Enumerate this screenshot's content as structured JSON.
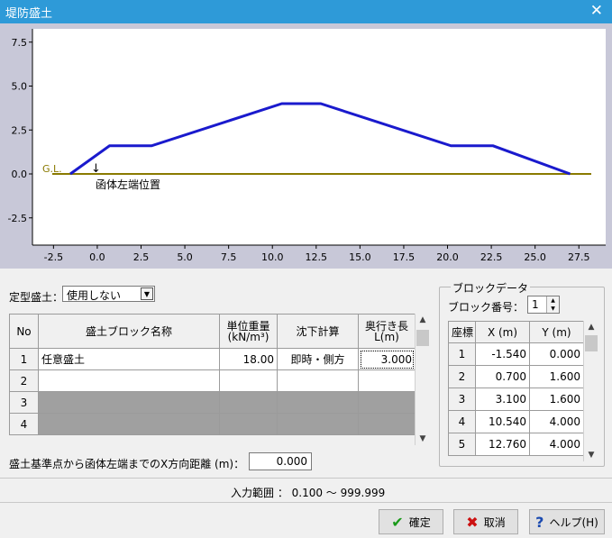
{
  "window": {
    "title": "堤防盛土",
    "close_glyph": "✕"
  },
  "plot": {
    "y_ticks": [
      "7.5",
      "5.0",
      "2.5",
      "0.0",
      "-2.5"
    ],
    "x_ticks": [
      "-2.5",
      "0.0",
      "2.5",
      "5.0",
      "7.5",
      "10.0",
      "12.5",
      "15.0",
      "17.5",
      "20.0",
      "22.5",
      "25.0",
      "27.5"
    ],
    "gl_label": "G.L.",
    "marker_label": "函体左端位置",
    "marker_arrow": "↓",
    "colors": {
      "embankment": "#1a1acd",
      "ground": "#8a7a00",
      "background": "#c8c8d8"
    },
    "profile": [
      [
        -1.54,
        0.0
      ],
      [
        0.7,
        1.6
      ],
      [
        3.1,
        1.6
      ],
      [
        10.54,
        4.0
      ],
      [
        12.76,
        4.0
      ],
      [
        20.2,
        1.6
      ],
      [
        22.6,
        1.6
      ],
      [
        27.0,
        0.0
      ]
    ]
  },
  "form": {
    "fixed_embankment_label": "定型盛土：",
    "fixed_embankment_value": "使用しない",
    "combo_arrow": "▼",
    "block_table": {
      "headers": [
        "No",
        "盛土ブロック名称",
        "単位重量\n(kN/m³)",
        "沈下計算",
        "奥行き長\nL(m)"
      ],
      "rows": [
        {
          "no": "1",
          "name": "任意盛土",
          "weight": "18.00",
          "calc": "即時・側方",
          "length": "3.000"
        },
        {
          "no": "2",
          "name": "",
          "weight": "",
          "calc": "",
          "length": ""
        },
        {
          "no": "3",
          "name": "",
          "weight": "",
          "calc": "",
          "length": ""
        },
        {
          "no": "4",
          "name": "",
          "weight": "",
          "calc": "",
          "length": ""
        }
      ]
    },
    "distance_label": "盛土基準点から函体左端までのX方向距離 (m)：",
    "distance_value": "0.000",
    "block_data": {
      "group_label": "ブロックデータ",
      "block_no_label": "ブロック番号：",
      "block_no_value": "1",
      "coord_headers": [
        "座標",
        "X (m)",
        "Y (m)"
      ],
      "coords": [
        {
          "no": "1",
          "x": "-1.540",
          "y": "0.000"
        },
        {
          "no": "2",
          "x": "0.700",
          "y": "1.600"
        },
        {
          "no": "3",
          "x": "3.100",
          "y": "1.600"
        },
        {
          "no": "4",
          "x": "10.540",
          "y": "4.000"
        },
        {
          "no": "5",
          "x": "12.760",
          "y": "4.000"
        }
      ]
    }
  },
  "status": {
    "input_range": "入力範囲 ： 0.100 〜 999.999"
  },
  "buttons": {
    "ok": {
      "label": "確定",
      "icon_glyph": "✔",
      "color": "#1a9a1a"
    },
    "cancel": {
      "label": "取消",
      "icon_glyph": "✖",
      "color": "#cc1010"
    },
    "help": {
      "label": "ヘルプ(H)",
      "icon_glyph": "?",
      "color": "#1a4ab0"
    }
  }
}
